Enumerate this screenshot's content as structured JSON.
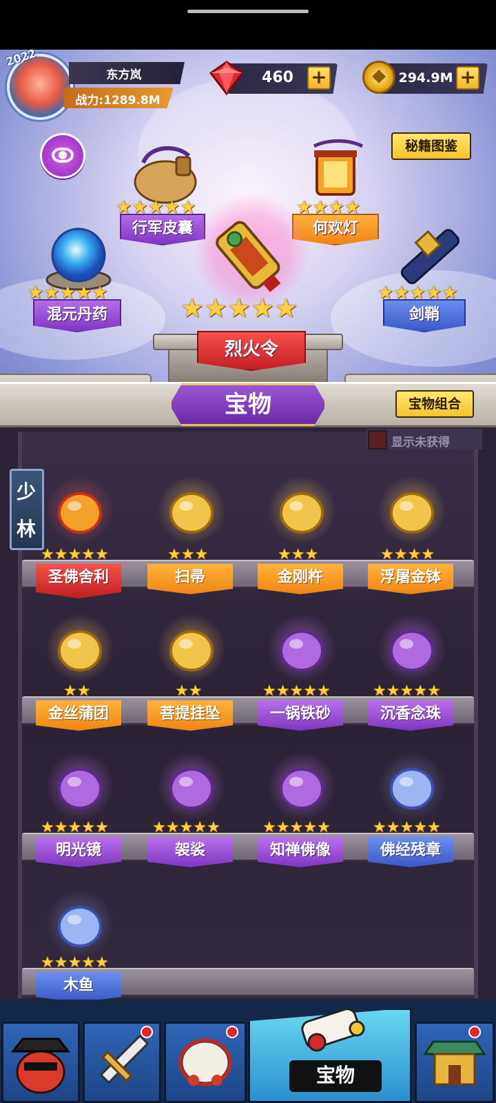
{
  "header": {
    "avatar_year": "2022",
    "player_name": "东方岚",
    "power": "战力:1289.8M",
    "gems": "460",
    "coins": "294.9M",
    "plus_symbol": "+",
    "codex_label": "秘籍图鉴"
  },
  "showcase": {
    "featured": {
      "name": "烈火令",
      "stars": 5
    },
    "items": [
      {
        "name": "行军皮囊",
        "stars": 5
      },
      {
        "name": "何欢灯",
        "stars": 4
      },
      {
        "name": "混元丹药",
        "stars": 5
      },
      {
        "name": "剑鞘",
        "stars": 5
      }
    ]
  },
  "tab": {
    "title": "宝物",
    "combo_label": "宝物组合"
  },
  "filter": {
    "show_unowned_label": "显示未获得"
  },
  "sect": {
    "char1": "少",
    "char2": "林"
  },
  "treasures": [
    {
      "name": "圣佛舍利",
      "stars": 5,
      "rarity": "red"
    },
    {
      "name": "扫帚",
      "stars": 3,
      "rarity": "orange"
    },
    {
      "name": "金刚杵",
      "stars": 3,
      "rarity": "orange"
    },
    {
      "name": "浮屠金钵",
      "stars": 4,
      "rarity": "orange"
    },
    {
      "name": "金丝蒲团",
      "stars": 2,
      "rarity": "orange"
    },
    {
      "name": "菩提挂坠",
      "stars": 2,
      "rarity": "orange"
    },
    {
      "name": "一锅铁砂",
      "stars": 5,
      "rarity": "purple"
    },
    {
      "name": "沉香念珠",
      "stars": 5,
      "rarity": "purple"
    },
    {
      "name": "明光镜",
      "stars": 5,
      "rarity": "purple"
    },
    {
      "name": "袈裟",
      "stars": 5,
      "rarity": "purple"
    },
    {
      "name": "知禅佛像",
      "stars": 5,
      "rarity": "purple"
    },
    {
      "name": "佛经残章",
      "stars": 5,
      "rarity": "blue"
    },
    {
      "name": "木鱼",
      "stars": 5,
      "rarity": "blue"
    }
  ],
  "bottom_nav": {
    "active_label": "宝物"
  },
  "colors": {
    "purple": "#8a45cc",
    "orange": "#f39a22",
    "blue": "#4a6ad8",
    "red": "#d42a2a",
    "star": "#ffd23d"
  }
}
